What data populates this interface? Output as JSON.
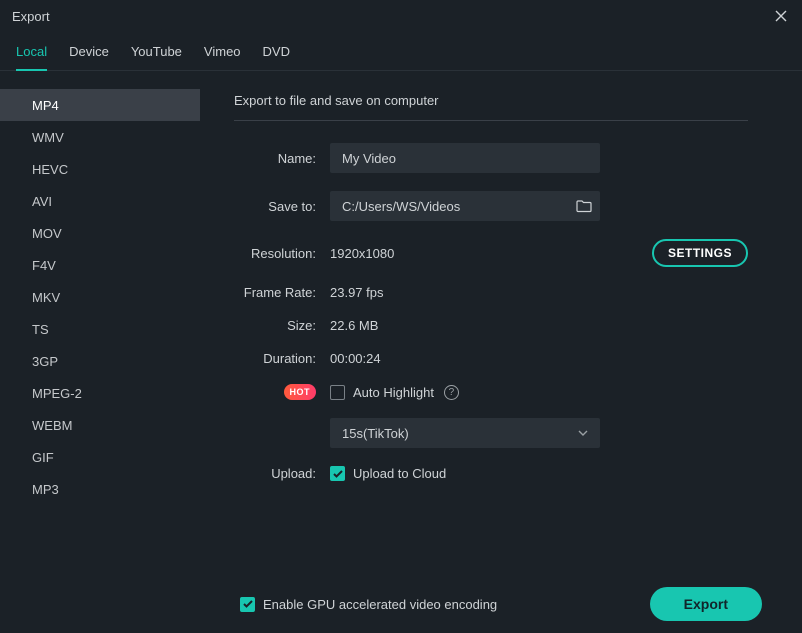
{
  "window": {
    "title": "Export"
  },
  "tabs": [
    {
      "label": "Local",
      "active": true
    },
    {
      "label": "Device"
    },
    {
      "label": "YouTube"
    },
    {
      "label": "Vimeo"
    },
    {
      "label": "DVD"
    }
  ],
  "formats": [
    "MP4",
    "WMV",
    "HEVC",
    "AVI",
    "MOV",
    "F4V",
    "MKV",
    "TS",
    "3GP",
    "MPEG-2",
    "WEBM",
    "GIF",
    "MP3"
  ],
  "selected_format_index": 0,
  "section_title": "Export to file and save on computer",
  "fields": {
    "name_label": "Name:",
    "name_value": "My Video",
    "save_to_label": "Save to:",
    "save_to_value": "C:/Users/WS/Videos",
    "resolution_label": "Resolution:",
    "resolution_value": "1920x1080",
    "frame_rate_label": "Frame Rate:",
    "frame_rate_value": "23.97 fps",
    "size_label": "Size:",
    "size_value": "22.6 MB",
    "duration_label": "Duration:",
    "duration_value": "00:00:24",
    "auto_highlight_label": "Auto Highlight",
    "hot_badge": "HOT",
    "highlight_preset": "15s(TikTok)",
    "upload_label": "Upload:",
    "upload_checkbox_label": "Upload to Cloud",
    "settings_button": "SETTINGS"
  },
  "footer": {
    "gpu_label": "Enable GPU accelerated video encoding",
    "gpu_checked": true,
    "export_button": "Export"
  },
  "state": {
    "auto_highlight_checked": false,
    "upload_checked": true
  }
}
